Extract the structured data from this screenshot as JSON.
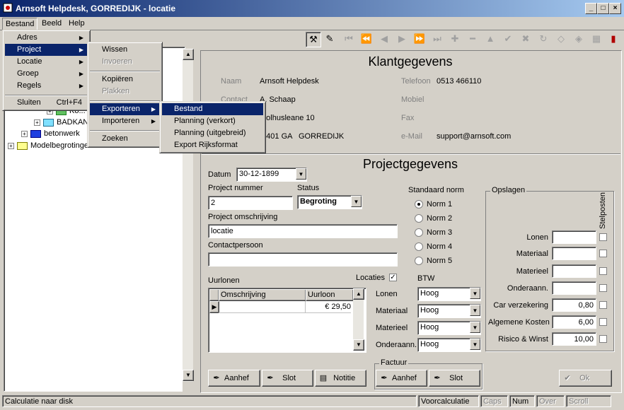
{
  "window": {
    "title": "Arnsoft Helpdesk, GORREDIJK - locatie",
    "controls": [
      "_",
      "□",
      "×"
    ]
  },
  "menubar": [
    "Bestand",
    "Beeld",
    "Help"
  ],
  "menu_bestand": {
    "items": [
      "Adres",
      "Project",
      "Locatie",
      "Groep",
      "Regels"
    ],
    "sluiten": "Sluiten",
    "sluiten_shortcut": "Ctrl+F4"
  },
  "menu_project": {
    "wissen": "Wissen",
    "invoeren": "Invoeren",
    "kopieren": "Kopiëren",
    "plakken": "Plakken",
    "exporteren": "Exporteren",
    "importeren": "Importeren",
    "zoeken": "Zoeken"
  },
  "menu_exporteren": [
    "Bestand",
    "Planning (verkort)",
    "Planning (uitgebreid)",
    "Export Rijksformat"
  ],
  "tree": {
    "items": [
      "Ko...",
      "BADKAN",
      "betonwerk",
      "Modelbegrotingen"
    ]
  },
  "klant": {
    "title": "Klantgegevens",
    "naam_label": "Naam",
    "naam": "Arnsoft Helpdesk",
    "contact_label": "Contact",
    "contact": "A. Schaap",
    "adres": "...olhusleane 10",
    "postcode": "...401 GA",
    "plaats": "GORREDIJK",
    "telefoon_label": "Telefoon",
    "telefoon": "0513 466110",
    "mobiel_label": "Mobiel",
    "fax_label": "Fax",
    "email_label": "e-Mail",
    "email": "support@arnsoft.com"
  },
  "project": {
    "title": "Projectgegevens",
    "datum_label": "Datum",
    "datum": "30-12-1899",
    "nummer_label": "Project nummer",
    "nummer": "2",
    "status_label": "Status",
    "status": "Begroting",
    "omschrijving_label": "Project omschrijving",
    "omschrijving": "locatie",
    "contactpersoon_label": "Contactpersoon",
    "contactpersoon": "",
    "norm_label": "Standaard norm",
    "normen": [
      "Norm 1",
      "Norm 2",
      "Norm 3",
      "Norm 4",
      "Norm 5"
    ],
    "norm_selected": 0,
    "uurlonen_label": "Uurlonen",
    "locaties_label": "Locaties",
    "grid_headers": [
      "Omschrijving",
      "Uurloon"
    ],
    "grid_row": {
      "omschrijving": "",
      "uurloon": "€ 29,50"
    },
    "btw_label": "BTW",
    "btw": [
      {
        "label": "Lonen",
        "value": "Hoog"
      },
      {
        "label": "Materiaal",
        "value": "Hoog"
      },
      {
        "label": "Materieel",
        "value": "Hoog"
      },
      {
        "label": "Onderaann.",
        "value": "Hoog"
      }
    ],
    "opslagen_label": "Opslagen",
    "stelposten_label": "Stelposten",
    "opslagen": [
      {
        "label": "Lonen",
        "value": ""
      },
      {
        "label": "Materiaal",
        "value": ""
      },
      {
        "label": "Materieel",
        "value": ""
      },
      {
        "label": "Onderaann.",
        "value": ""
      },
      {
        "label": "Car verzekering",
        "value": "0,80"
      },
      {
        "label": "Algemene Kosten",
        "value": "6,00"
      },
      {
        "label": "Risico & Winst",
        "value": "10,00"
      }
    ],
    "factuur_label": "Factuur",
    "buttons": {
      "aanhef": "Aanhef",
      "slot": "Slot",
      "notitie": "Notitie",
      "ok": "Ok"
    }
  },
  "statusbar": {
    "message": "Calculatie naar disk",
    "mode": "Voorcalculatie",
    "caps": "Caps",
    "num": "Num",
    "over": "Over",
    "scroll": "Scroll"
  }
}
